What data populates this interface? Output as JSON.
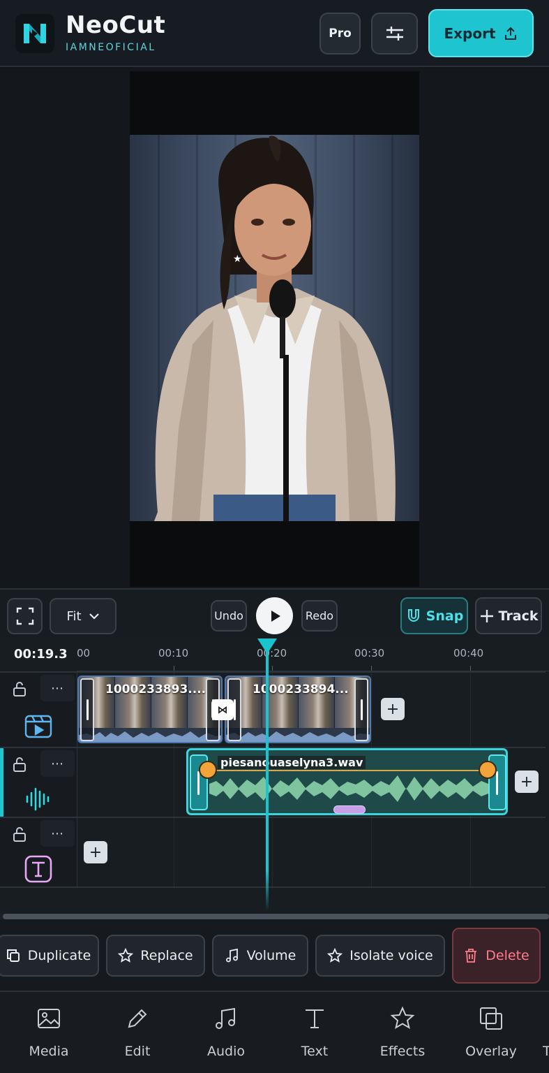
{
  "header": {
    "app_name": "NeoCut",
    "account": "IAMNEOFICIAL",
    "pro_label": "Pro",
    "export_label": "Export"
  },
  "controls": {
    "fit_label": "Fit",
    "undo_label": "Undo",
    "redo_label": "Redo",
    "snap_label": "Snap",
    "track_label": "Track"
  },
  "timeline": {
    "current_time": "00:19.3",
    "ruler_labels": [
      "00",
      "00:10",
      "00:20",
      "00:30",
      "00:40"
    ],
    "video_clips": [
      {
        "title": "1000233893...."
      },
      {
        "title": "1000233894..."
      }
    ],
    "audio_clip": {
      "title": "piesanouaselyna3.wav"
    }
  },
  "actions": {
    "duplicate": "Duplicate",
    "replace": "Replace",
    "volume": "Volume",
    "isolate_voice": "Isolate voice",
    "delete": "Delete"
  },
  "nav": {
    "items": [
      {
        "label": "Media"
      },
      {
        "label": "Edit"
      },
      {
        "label": "Audio"
      },
      {
        "label": "Text"
      },
      {
        "label": "Effects"
      },
      {
        "label": "Overlay"
      },
      {
        "label": "T"
      }
    ]
  },
  "colors": {
    "accent": "#1fc4d1",
    "video_track": "#4f7ab0",
    "audio_track": "#35d6dd",
    "text_track": "#e7a8f5",
    "delete": "#ff7d8a"
  }
}
